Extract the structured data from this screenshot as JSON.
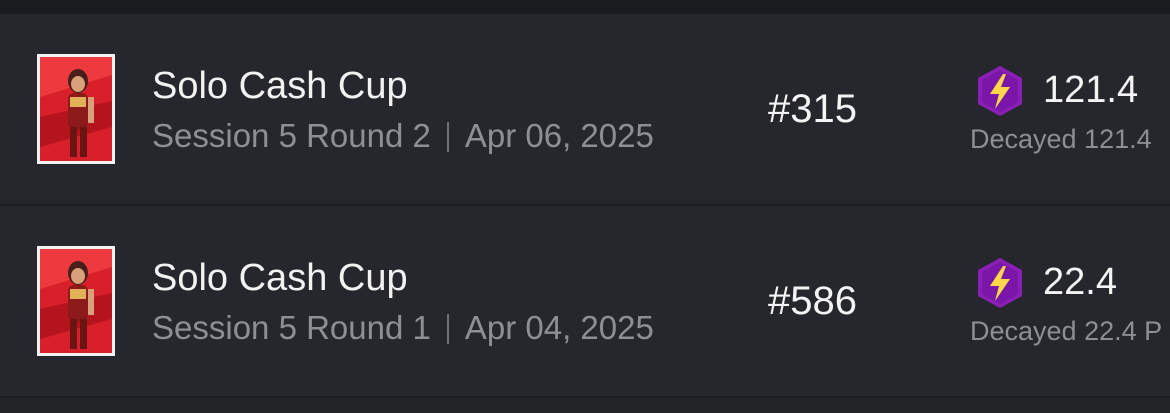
{
  "colors": {
    "background": "#202226",
    "row_background": "#25272c",
    "title_text": "#f2f2f2",
    "muted_text": "#8d8f95",
    "points_icon_fill": "#8a1fb8",
    "points_bolt": "#ffd84a"
  },
  "rows": [
    {
      "title": "Solo Cash Cup",
      "session": "Session 5 Round 2",
      "date": "Apr 06, 2025",
      "rank": "#315",
      "points": "121.4",
      "decayed": "Decayed 121.4",
      "icon": "lightning-hexagon-icon"
    },
    {
      "title": "Solo Cash Cup",
      "session": "Session 5 Round 1",
      "date": "Apr 04, 2025",
      "rank": "#586",
      "points": "22.4",
      "decayed": "Decayed 22.4 P",
      "icon": "lightning-hexagon-icon"
    }
  ]
}
